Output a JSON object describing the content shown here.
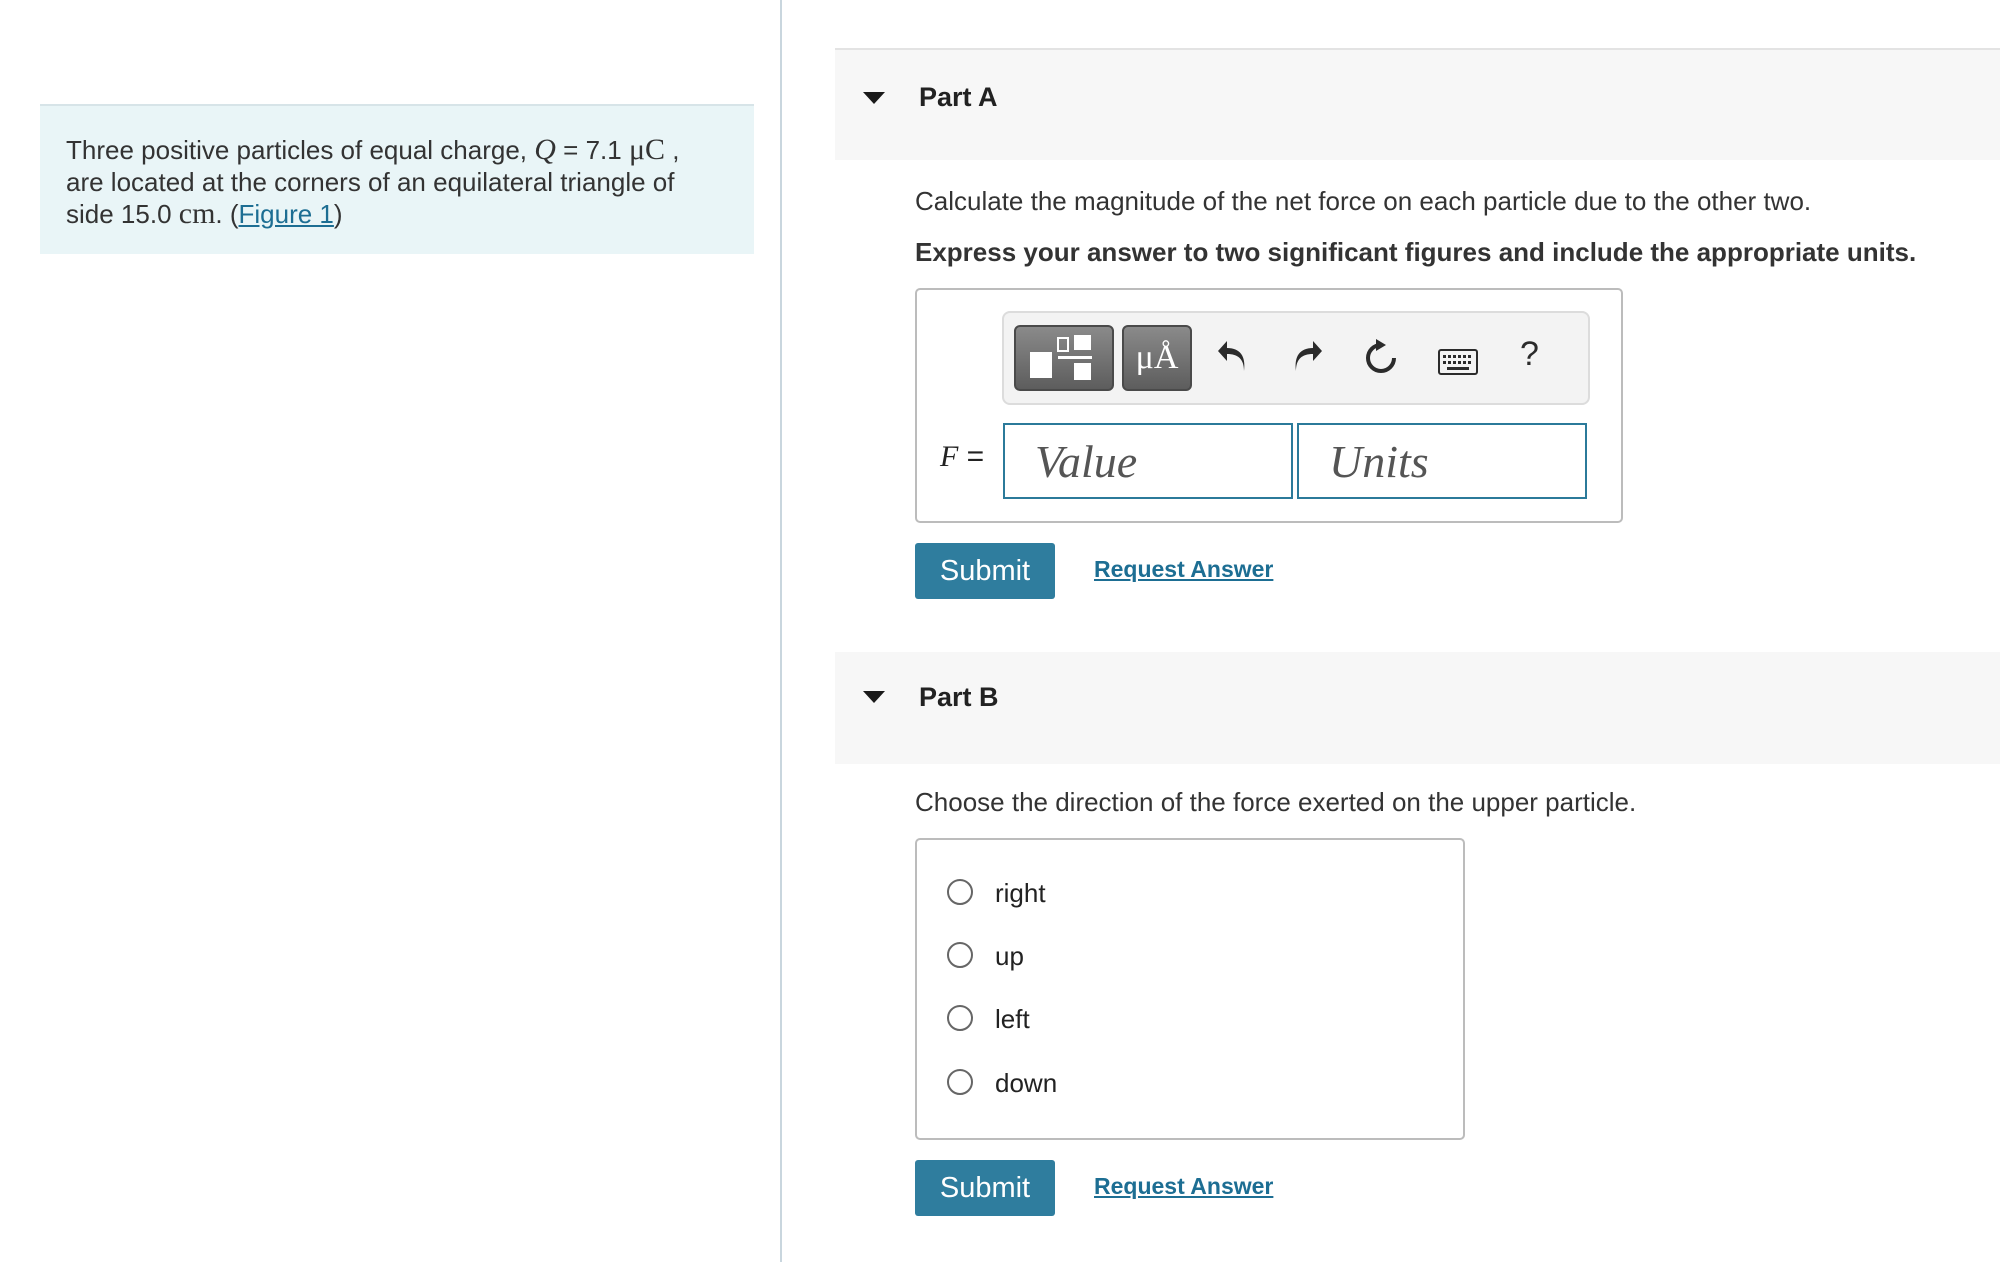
{
  "problem": {
    "text_before": "Three positive particles of equal charge, ",
    "var_q": "Q",
    "equals": " = 7.1 ",
    "unit_uc": "μC",
    "text_mid_line1": " ,",
    "text_line2": "are located at the corners of an equilateral triangle of",
    "text_line3_start": "side 15.0 ",
    "unit_cm": "cm",
    "text_after_cm": ". (",
    "figure_link": "Figure 1",
    "close_paren": ")"
  },
  "part_a": {
    "title": "Part A",
    "question": "Calculate the magnitude of the net force on each particle due to the other two.",
    "instruction": "Express your answer to two significant figures and include the appropriate units.",
    "toolbar": {
      "units_symbol": "μÅ",
      "help": "?",
      "icons": [
        "templates-icon",
        "units-icon",
        "undo-icon",
        "redo-icon",
        "reset-icon",
        "keyboard-icon",
        "help-icon"
      ]
    },
    "variable": "F",
    "equals": " =",
    "value_placeholder": "Value",
    "units_placeholder": "Units",
    "submit_label": "Submit",
    "request_label": "Request Answer"
  },
  "part_b": {
    "title": "Part B",
    "question": "Choose the direction of the force exerted on the upper particle.",
    "options": [
      "right",
      "up",
      "left",
      "down"
    ],
    "submit_label": "Submit",
    "request_label": "Request Answer"
  },
  "colors": {
    "accent": "#2f7d9e",
    "link": "#1d6e93",
    "problem_bg": "#e9f5f7",
    "header_bg": "#f7f7f7"
  }
}
